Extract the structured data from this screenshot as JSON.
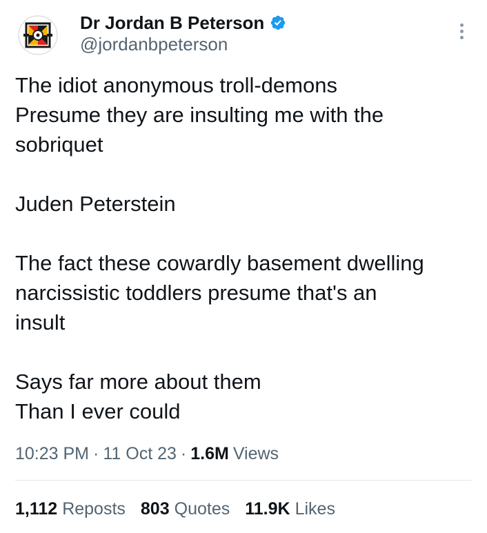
{
  "author": {
    "display_name": "Dr Jordan B Peterson",
    "handle": "@jordanbpeterson",
    "verified": true,
    "verified_color": "#1d9bf0"
  },
  "icons": {
    "avatar": "avatar-logo",
    "verified": "verified-badge-icon",
    "more": "more-options-icon"
  },
  "tweet": {
    "lines": [
      "The idiot anonymous troll-demons",
      "Presume they are insulting me with the",
      "sobriquet",
      "",
      "Juden Peterstein",
      "",
      "The fact these cowardly basement dwelling",
      "narcissistic toddlers presume that's an",
      "insult",
      "",
      "Says far more about them",
      "Than I ever could"
    ]
  },
  "meta": {
    "time": "10:23 PM",
    "separator": "·",
    "date": "11 Oct 23",
    "views_count": "1.6M",
    "views_label": "Views"
  },
  "stats": {
    "reposts_count": "1,112",
    "reposts_label": "Reposts",
    "quotes_count": "803",
    "quotes_label": "Quotes",
    "likes_count": "11.9K",
    "likes_label": "Likes"
  },
  "colors": {
    "text_primary": "#0f1419",
    "text_secondary": "#536471",
    "divider": "#e1e8ed"
  }
}
